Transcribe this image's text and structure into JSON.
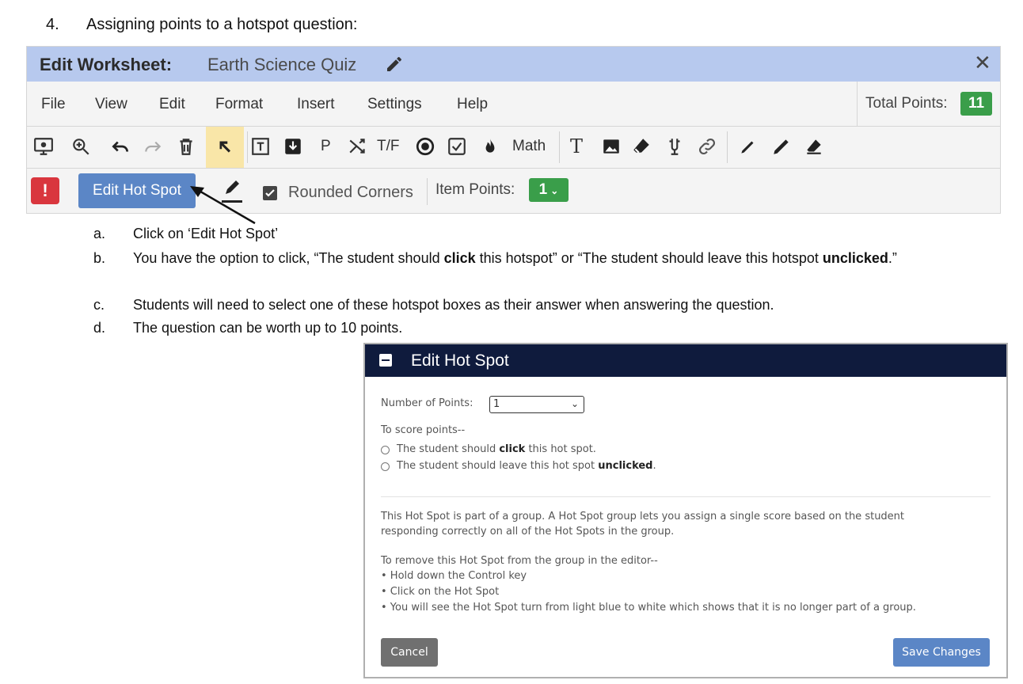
{
  "step": {
    "number": "4.",
    "title": "Assigning points to a hotspot question:"
  },
  "editor": {
    "header_label": "Edit Worksheet:",
    "doc_title": "Earth Science Quiz",
    "close_symbol": "✕",
    "menu": [
      "File",
      "View",
      "Edit",
      "Format",
      "Insert",
      "Settings",
      "Help"
    ],
    "total_points_label": "Total Points:",
    "total_points_value": "11",
    "toolbar_text": {
      "p": "P",
      "tf": "T/F",
      "math": "Math",
      "t": "T"
    },
    "alert_symbol": "!",
    "edit_hot_spot_label": "Edit Hot Spot",
    "rounded_corners_label": "Rounded Corners",
    "item_points_label": "Item Points:",
    "item_points_value": "1",
    "accent_header": "#b7c9ee",
    "badge_green": "#3a9e4a"
  },
  "instructions": [
    {
      "letter": "a.",
      "text": "Click on ‘Edit Hot Spot’"
    },
    {
      "letter": "b.",
      "pre": "You have the option to click, “The student should ",
      "bold1": "click",
      "mid": " this hotspot” or “The student should leave this hotspot ",
      "bold2": "unclicked",
      "post": ".”"
    },
    {
      "letter": "c.",
      "text": "Students will need to select one of these hotspot boxes as their answer when answering the question."
    },
    {
      "letter": "d.",
      "text": "The question can be worth up to 10 points."
    }
  ],
  "dialog": {
    "title": "Edit Hot Spot",
    "number_of_points_label": "Number of Points:",
    "number_of_points_value": "1",
    "to_score_label": "To score points--",
    "option1_pre": "The student should ",
    "option1_bold": "click",
    "option1_post": " this hot spot.",
    "option2_pre": "The student should leave this hot spot ",
    "option2_bold": "unclicked",
    "option2_post": ".",
    "group_line1": "This Hot Spot is part of a group. A Hot Spot group lets you assign a single score based on the student",
    "group_line2": "responding correctly on all of the Hot Spots in the group.",
    "remove_title": "To remove this Hot Spot from the group in the editor--",
    "remove_steps": [
      "• Hold down the Control key",
      "• Click on the Hot Spot",
      "• You will see the Hot Spot turn from light blue to white which shows that it is no longer part of a group."
    ],
    "cancel_label": "Cancel",
    "save_label": "Save Changes",
    "header_color": "#0f1b3d",
    "save_color": "#5b86c6"
  }
}
